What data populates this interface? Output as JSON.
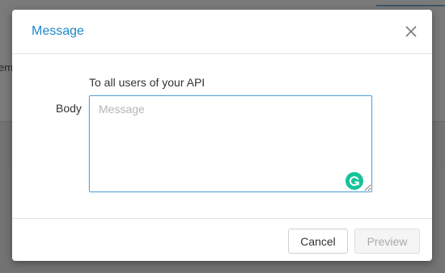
{
  "background": {
    "fragment_text": "em"
  },
  "modal": {
    "title": "Message",
    "close_icon": "close-icon",
    "intro": "To all users of your API",
    "body_label": "Body",
    "body_placeholder": "Message",
    "body_value": "",
    "grammarly_icon": "grammarly-icon",
    "cancel_label": "Cancel",
    "preview_label": "Preview"
  },
  "colors": {
    "accent": "#1e88c9",
    "grammarly": "#15c39a",
    "input_border": "#5aa5d8"
  }
}
